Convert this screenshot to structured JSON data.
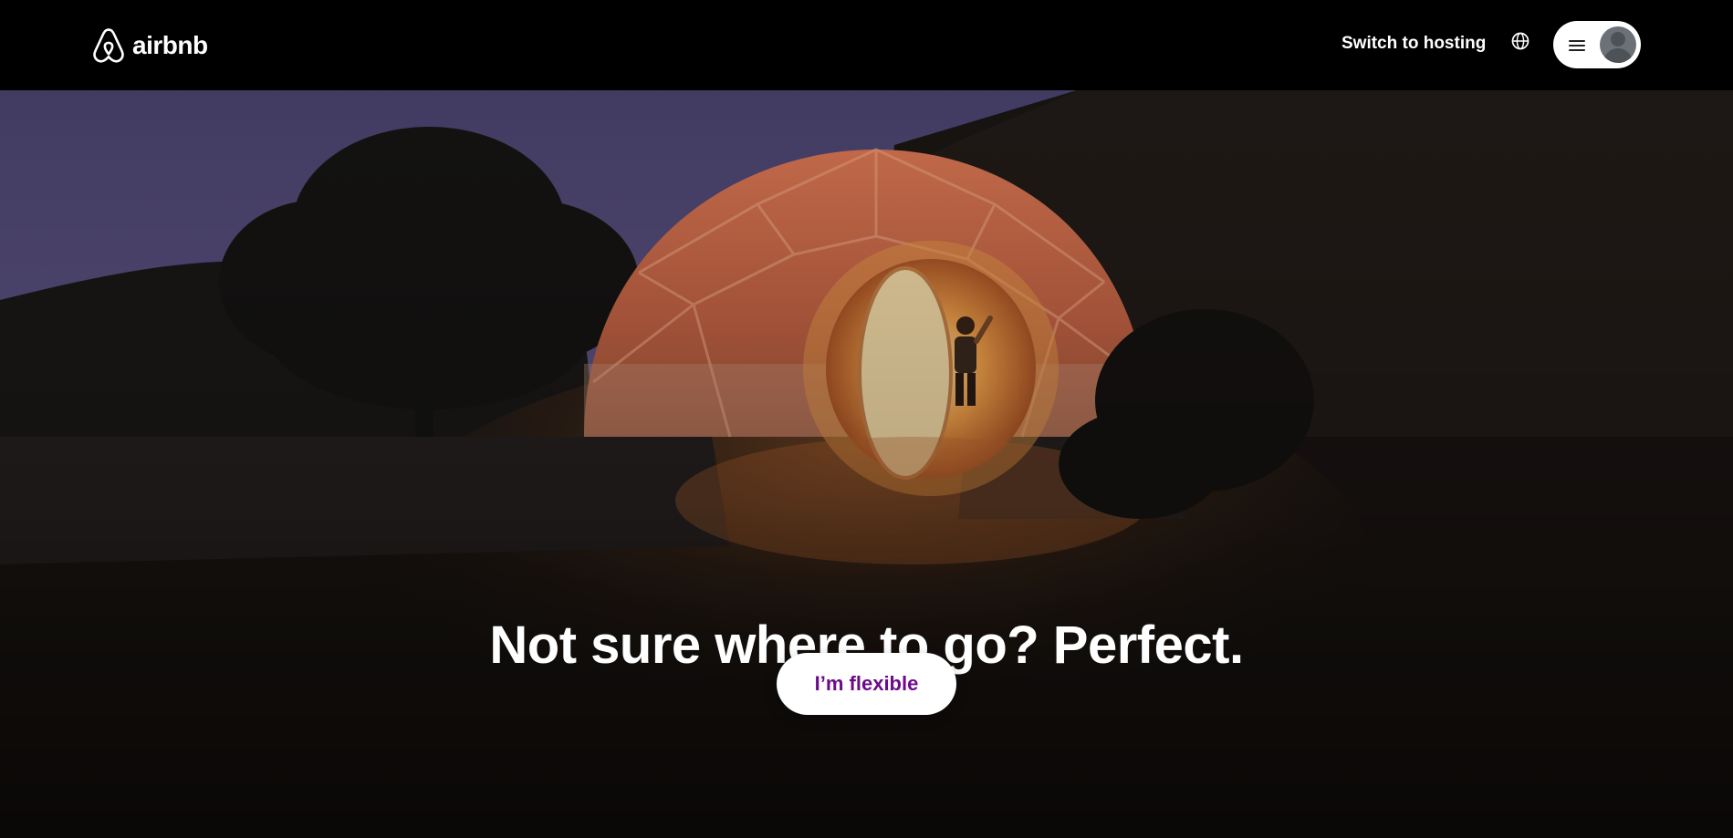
{
  "header": {
    "logo_text": "airbnb",
    "switch_hosting_label": "Switch to hosting",
    "globe_icon": "globe-icon",
    "menu_icon": "hamburger-menu-icon",
    "avatar_icon": "user-avatar-icon"
  },
  "hero": {
    "title": "Not sure where to go? Perfect.",
    "cta_label": "I’m flexible",
    "cta_color": "#6c0b8a",
    "image": "illuminated geodesic dome tent at dusk with person waving in round doorway"
  },
  "colors": {
    "header_bg": "#000000",
    "text_light": "#ffffff",
    "accent_purple": "#6c0b8a"
  }
}
